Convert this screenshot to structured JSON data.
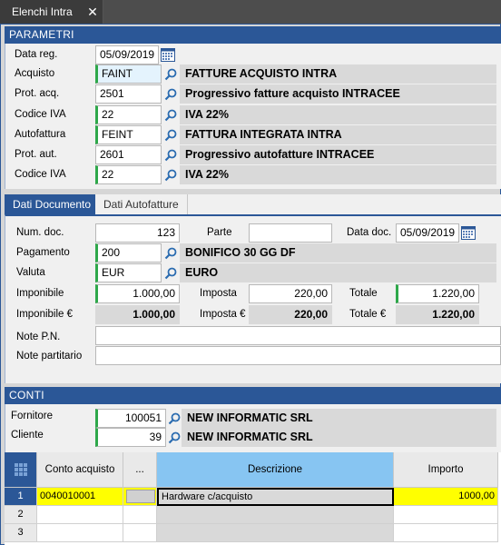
{
  "window": {
    "tab_title": "Elenchi Intra",
    "close_symbol": "✕"
  },
  "parametri": {
    "header": "PARAMETRI",
    "data_reg": {
      "label": "Data reg.",
      "value": "05/09/2019"
    },
    "acquisto": {
      "label": "Acquisto",
      "code": "FAINT",
      "desc": "FATTURE ACQUISTO INTRA"
    },
    "prot_acq": {
      "label": "Prot. acq.",
      "code": "2501",
      "desc": "Progressivo fatture acquisto INTRACEE"
    },
    "codice_iva_1": {
      "label": "Codice IVA",
      "code": "22",
      "desc": "IVA 22%"
    },
    "autofattura": {
      "label": "Autofattura",
      "code": "FEINT",
      "desc": "FATTURA INTEGRATA INTRA"
    },
    "prot_aut": {
      "label": "Prot. aut.",
      "code": "2601",
      "desc": "Progressivo autofatture INTRACEE"
    },
    "codice_iva_2": {
      "label": "Codice IVA",
      "code": "22",
      "desc": "IVA 22%"
    }
  },
  "subtabs": {
    "dati_documento": "Dati Documento",
    "dati_autofatture": "Dati Autofatture"
  },
  "documento": {
    "num_doc": {
      "label": "Num. doc.",
      "value": "123"
    },
    "parte": {
      "label": "Parte",
      "value": ""
    },
    "data_doc": {
      "label": "Data doc.",
      "value": "05/09/2019"
    },
    "pagamento": {
      "label": "Pagamento",
      "code": "200",
      "desc": "BONIFICO 30 GG DF"
    },
    "valuta": {
      "label": "Valuta",
      "code": "EUR",
      "desc": "EURO"
    },
    "imponibile": {
      "label": "Imponibile",
      "value": "1.000,00"
    },
    "imposta": {
      "label": "Imposta",
      "value": "220,00"
    },
    "totale": {
      "label": "Totale",
      "value": "1.220,00"
    },
    "imponibile_eur": {
      "label": "Imponibile €",
      "value": "1.000,00"
    },
    "imposta_eur": {
      "label": "Imposta €",
      "value": "220,00"
    },
    "totale_eur": {
      "label": "Totale €",
      "value": "1.220,00"
    },
    "note_pn": {
      "label": "Note P.N.",
      "value": ""
    },
    "note_partitario": {
      "label": "Note partitario",
      "value": ""
    }
  },
  "conti": {
    "header": "CONTI",
    "fornitore": {
      "label": "Fornitore",
      "code": "100051",
      "desc": "NEW INFORMATIC SRL"
    },
    "cliente": {
      "label": "Cliente",
      "code": "39",
      "desc": "NEW INFORMATIC SRL"
    }
  },
  "grid": {
    "columns": [
      "Conto acquisto",
      "...",
      "Descrizione",
      "Importo"
    ],
    "rows": [
      {
        "num": "1",
        "conto": "0040010001",
        "descrizione": "Hardware c/acquisto",
        "importo": "1000,00"
      },
      {
        "num": "2",
        "conto": "",
        "descrizione": "",
        "importo": ""
      },
      {
        "num": "3",
        "conto": "",
        "descrizione": "",
        "importo": ""
      }
    ]
  },
  "colors": {
    "header_blue": "#2b5797",
    "required_green": "#2ea84a",
    "selected_yellow": "#ffff00",
    "col_header_blue": "#87c5f2"
  }
}
